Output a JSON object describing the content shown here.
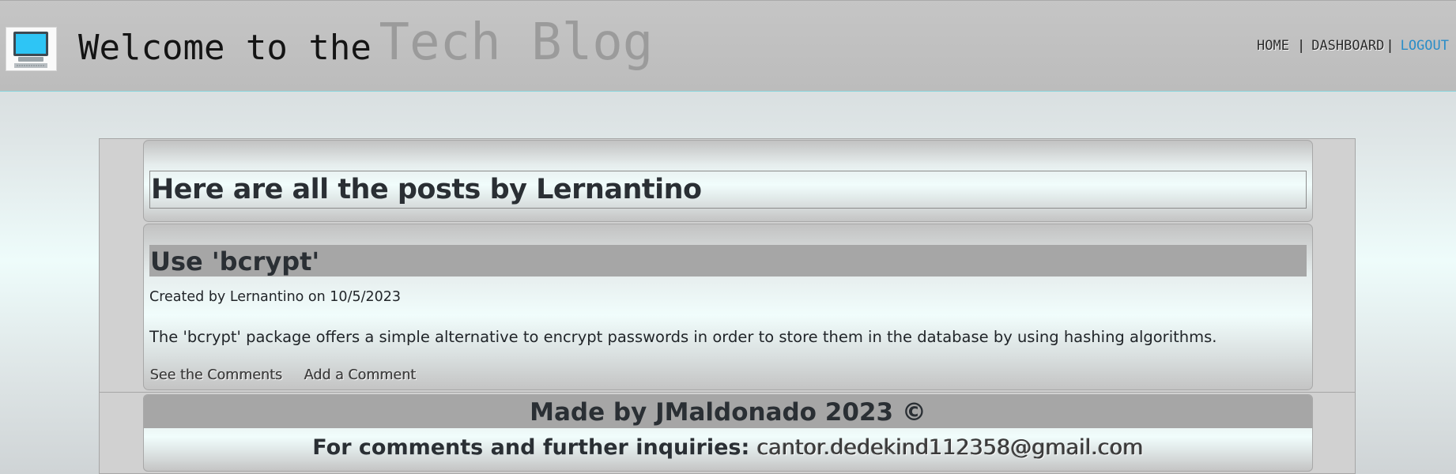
{
  "header": {
    "logo_icon": "computer-monitor-icon",
    "title_prefix": "Welcome to the",
    "title_brand": "Tech Blog",
    "nav": {
      "home": "HOME",
      "separator1": "|",
      "dashboard": "DASHBOARD",
      "separator2": "|",
      "logout": "LOGOUT"
    }
  },
  "main": {
    "heading": "Here are all the posts by Lernantino",
    "posts": [
      {
        "title": "Use 'bcrypt'",
        "meta": "Created by Lernantino on 10/5/2023",
        "body": "The 'bcrypt' package offers a simple alternative to encrypt passwords in order to store them in the database by using hashing algorithms.",
        "see_comments": "See the Comments",
        "add_comment": "Add a Comment"
      }
    ]
  },
  "footer": {
    "made_by": "Made by JMaldonado 2023 ©",
    "contact_label": "For comments and further inquiries: ",
    "email": "cantor.dedekind112358@gmail.com"
  },
  "colors": {
    "header_bg": "#bfbfbf",
    "brand_text": "#9b9b9b",
    "logout_link": "#2a8dc8",
    "title_bar_bg": "#a6a6a6"
  }
}
